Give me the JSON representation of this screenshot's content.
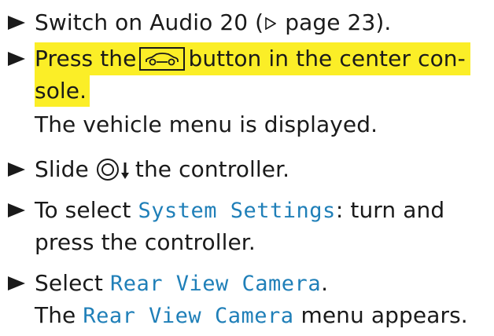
{
  "steps": [
    {
      "lines": [
        {
          "pre": "Switch on Audio 20 (",
          "ref_page": "page 23",
          "post": ")."
        }
      ]
    },
    {
      "highlighted": true,
      "lines": [
        {
          "pre": "Press the",
          "post": "button in the center con-"
        },
        {
          "text": "sole."
        }
      ],
      "result": "The vehicle menu is displayed.",
      "button_icon": "vehicle-button-icon"
    },
    {
      "lines": [
        {
          "pre": "Slide",
          "post": "the controller."
        }
      ],
      "controller_icon": "controller-slide-down-icon"
    },
    {
      "lines": [
        {
          "pre": "To select ",
          "menu": "System Settings",
          "post": ": turn and"
        },
        {
          "text": "press the controller."
        }
      ]
    },
    {
      "lines": [
        {
          "pre": "Select ",
          "menu": "Rear View Camera",
          "post": "."
        }
      ],
      "result": {
        "pre": "The ",
        "menu": "Rear View Camera",
        "post": " menu appears."
      }
    }
  ],
  "colors": {
    "highlight": "#fbee27",
    "menu_text": "#1f7fb8",
    "text": "#1a1a1a"
  }
}
